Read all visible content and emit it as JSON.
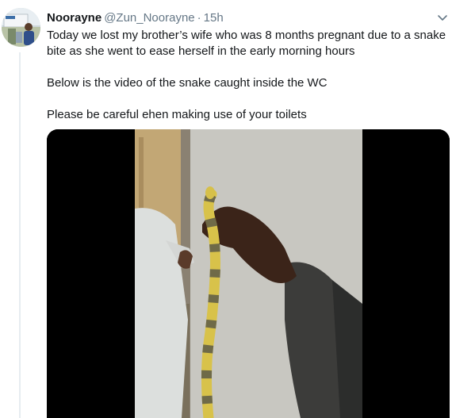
{
  "tweet": {
    "author_name": "Noorayne",
    "author_handle": "@Zun_Noorayne",
    "separator": "·",
    "time_ago": "15h",
    "paragraphs": [
      "Today we lost my brother’s wife who was 8 months pregnant due to a snake bite as she went to ease herself in the early morning hours",
      "Below is the video of the snake caught inside the WC",
      "Please be careful ehen making use of your toilets"
    ],
    "more_icon": "chevron-down-icon",
    "media_type": "video"
  },
  "colors": {
    "name": "#14171a",
    "meta": "#657786",
    "thread_line": "#e6ecf0",
    "media_background": "#000000"
  }
}
